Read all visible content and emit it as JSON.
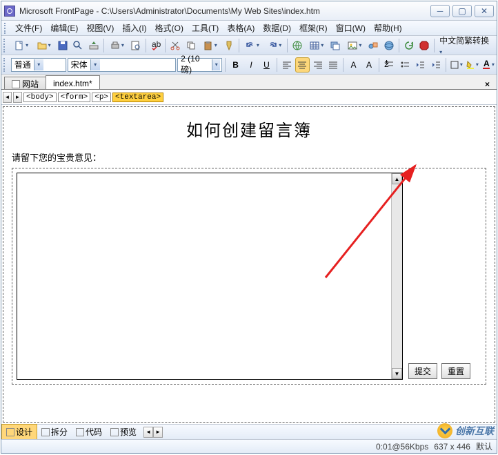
{
  "window": {
    "title": "Microsoft FrontPage - C:\\Users\\Administrator\\Documents\\My Web Sites\\index.htm"
  },
  "menus": {
    "file": "文件(F)",
    "edit": "编辑(E)",
    "view": "视图(V)",
    "insert": "插入(I)",
    "format": "格式(O)",
    "tools": "工具(T)",
    "table": "表格(A)",
    "data": "数据(D)",
    "frame": "框架(R)",
    "win": "窗口(W)",
    "help": "帮助(H)"
  },
  "toolbar": {
    "convert": "中文简繁转换"
  },
  "format": {
    "style": "普通",
    "font": "宋体",
    "size": "2 (10 磅)",
    "bold": "B",
    "italic": "I",
    "underline": "U",
    "sup": "A",
    "sub": "A"
  },
  "tabs": {
    "site": "网站",
    "file": "index.htm*"
  },
  "breadcrumb": {
    "body": "<body>",
    "form": "<form>",
    "p": "<p>",
    "textarea": "<textarea>"
  },
  "page": {
    "heading": "如何创建留言簿",
    "prompt": "请留下您的宝贵意见：",
    "submit": "提交",
    "reset": "重置"
  },
  "views": {
    "design": "设计",
    "split": "拆分",
    "code": "代码",
    "preview": "预览"
  },
  "status": {
    "time": "0:01@56Kbps",
    "dims": "637 x 446",
    "mode": "默认"
  },
  "watermark": {
    "text": "创新互联"
  }
}
